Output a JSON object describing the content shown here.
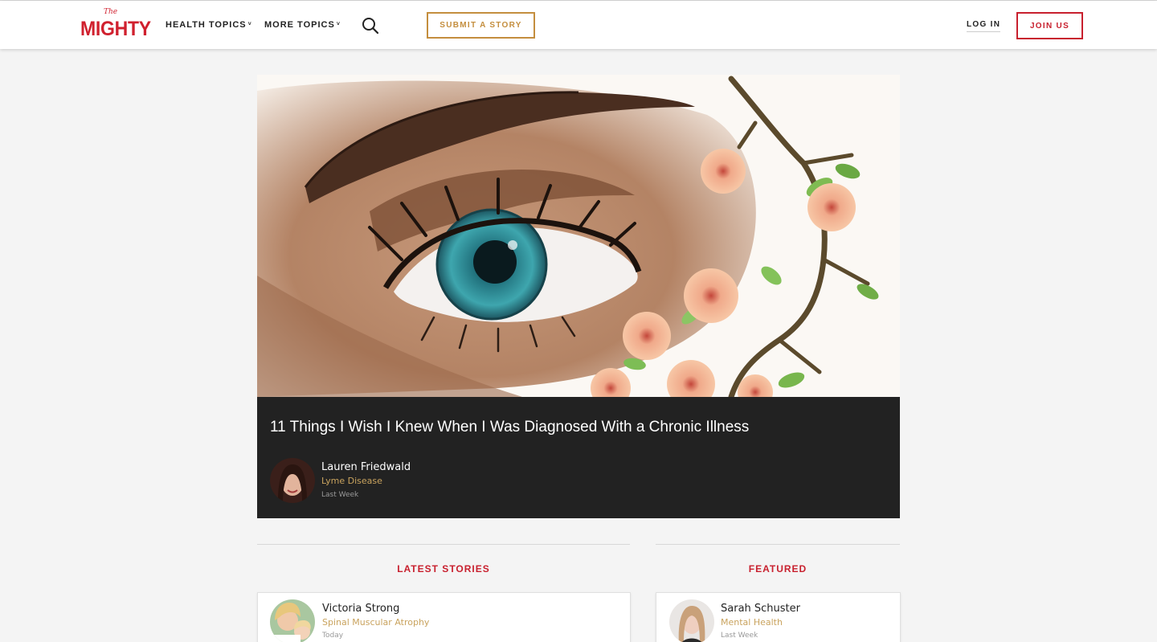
{
  "brand": {
    "logo_small": "The",
    "logo_main": "MIGHTY",
    "color": "#d0202e"
  },
  "nav": {
    "health_topics": "HEALTH TOPICS",
    "more_topics": "MORE TOPICS",
    "chevron": "˅",
    "search_icon": "search-icon",
    "submit_story": "SUBMIT A STORY",
    "log_in": "LOG IN",
    "join_us": "JOIN US"
  },
  "hero": {
    "title": "11 Things I Wish I Knew When I Was Diagnosed With a Chronic Illness",
    "author": "Lauren Friedwald",
    "topic": "Lyme Disease",
    "time": "Last Week"
  },
  "latest": {
    "heading": "LATEST STORIES",
    "card": {
      "author": "Victoria Strong",
      "topic": "Spinal Muscular Atrophy",
      "time": "Today"
    }
  },
  "featured": {
    "heading": "FEATURED",
    "card": {
      "author": "Sarah Schuster",
      "topic": "Mental Health",
      "time": "Last Week"
    }
  },
  "colors": {
    "accent_red": "#c8202e",
    "accent_gold": "#c48e3e",
    "topic_gold": "#c9a35e",
    "caption_bg": "#222222"
  }
}
